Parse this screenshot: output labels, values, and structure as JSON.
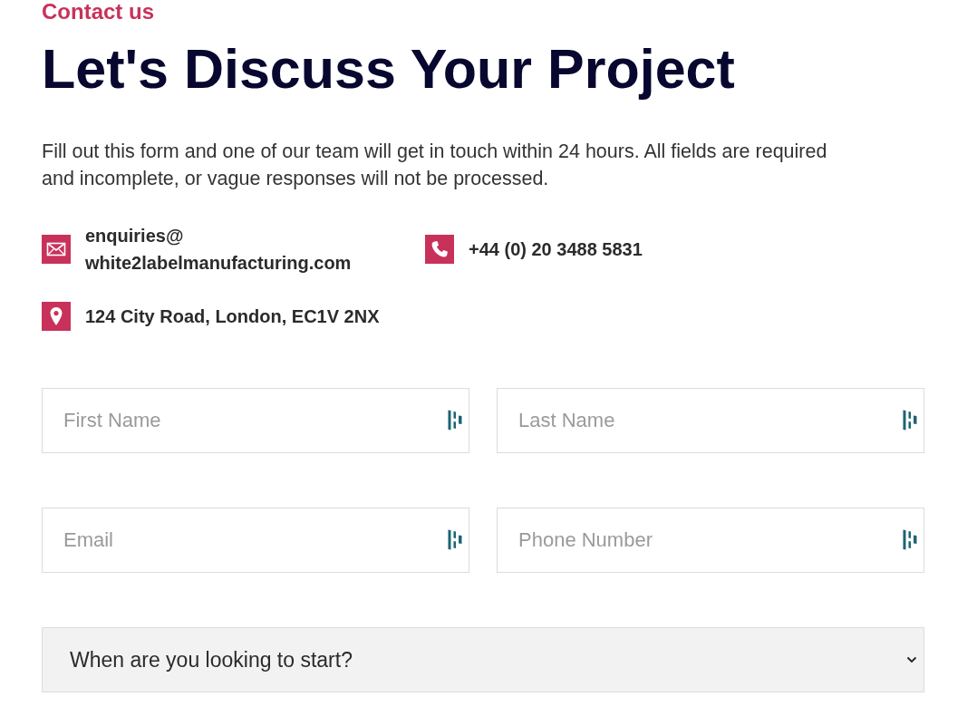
{
  "header": {
    "eyebrow": "Contact us",
    "title": "Let's Discuss Your Project",
    "intro": "Fill out this form and one of our team will get in touch within 24 hours. All fields are required and incomplete, or vague responses will not be processed."
  },
  "contacts": [
    {
      "kind": "email",
      "lines": [
        "enquiries@",
        "white2labelmanufacturing.com"
      ]
    },
    {
      "kind": "phone",
      "lines": [
        "+44 (0) 20 3488 5831"
      ]
    },
    {
      "kind": "address",
      "lines": [
        "124 City Road, London, EC1V 2NX"
      ]
    }
  ],
  "form": {
    "fields": [
      {
        "kind": "input",
        "placeholder": "First Name"
      },
      {
        "kind": "input",
        "placeholder": "Last Name"
      },
      {
        "kind": "input",
        "placeholder": "Email"
      },
      {
        "kind": "input",
        "placeholder": "Phone Number"
      },
      {
        "kind": "select",
        "value": "When are you looking to start?"
      }
    ]
  }
}
